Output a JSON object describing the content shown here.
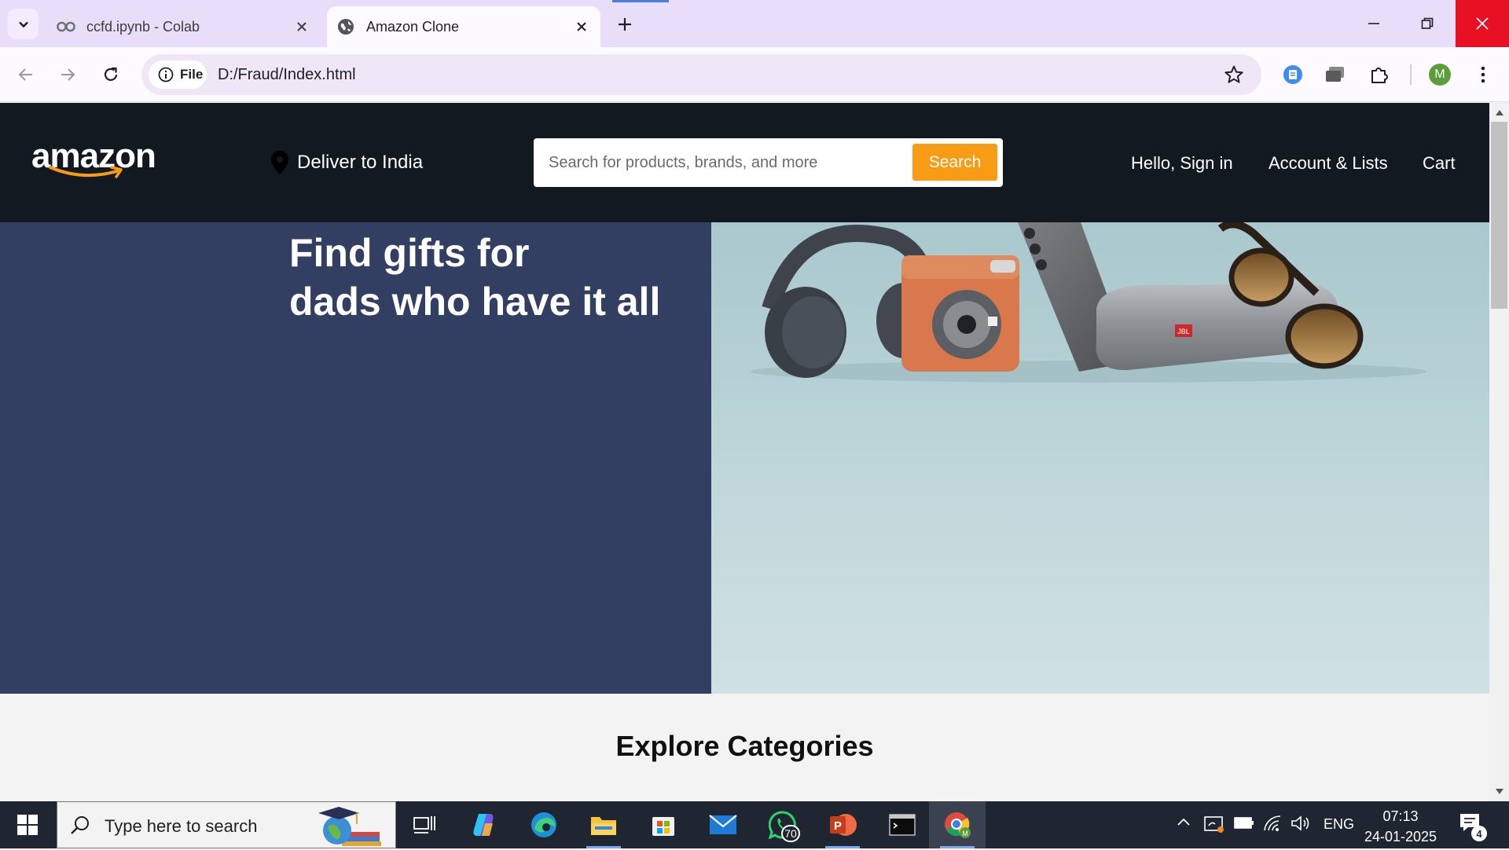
{
  "browser": {
    "tabs": [
      {
        "title": "ccfd.ipynb - Colab",
        "favicon": "colab-icon",
        "active": false
      },
      {
        "title": "Amazon Clone",
        "favicon": "globe-icon",
        "active": true
      }
    ],
    "address": {
      "scheme_chip": "File",
      "url": "D:/Fraud/Index.html"
    },
    "profile_initial": "M",
    "accent": "#4a7ee8"
  },
  "page": {
    "header": {
      "logo_text": "amazon",
      "deliver_label": "Deliver to India",
      "search_placeholder": "Search for products, brands, and more",
      "search_button": "Search",
      "nav": [
        "Hello, Sign in",
        "Account & Lists",
        "Cart"
      ],
      "bg_color": "#131921",
      "button_color": "#f99c15"
    },
    "hero": {
      "title_line1": "Find gifts for",
      "title_line2": "dads who have it all",
      "bg_left": "#323e62",
      "image_label": "JBL"
    },
    "section_title": "Explore Categories"
  },
  "taskbar": {
    "search_placeholder": "Type here to search",
    "apps": [
      {
        "name": "task-view-icon"
      },
      {
        "name": "copilot-icon"
      },
      {
        "name": "edge-icon"
      },
      {
        "name": "file-explorer-icon"
      },
      {
        "name": "microsoft-store-icon"
      },
      {
        "name": "mail-icon"
      },
      {
        "name": "whatsapp-icon",
        "badge": "70"
      },
      {
        "name": "powerpoint-icon"
      },
      {
        "name": "terminal-icon"
      },
      {
        "name": "chrome-icon"
      }
    ],
    "language": "ENG",
    "time": "07:13",
    "date": "24-01-2025",
    "notification_count": "4"
  }
}
